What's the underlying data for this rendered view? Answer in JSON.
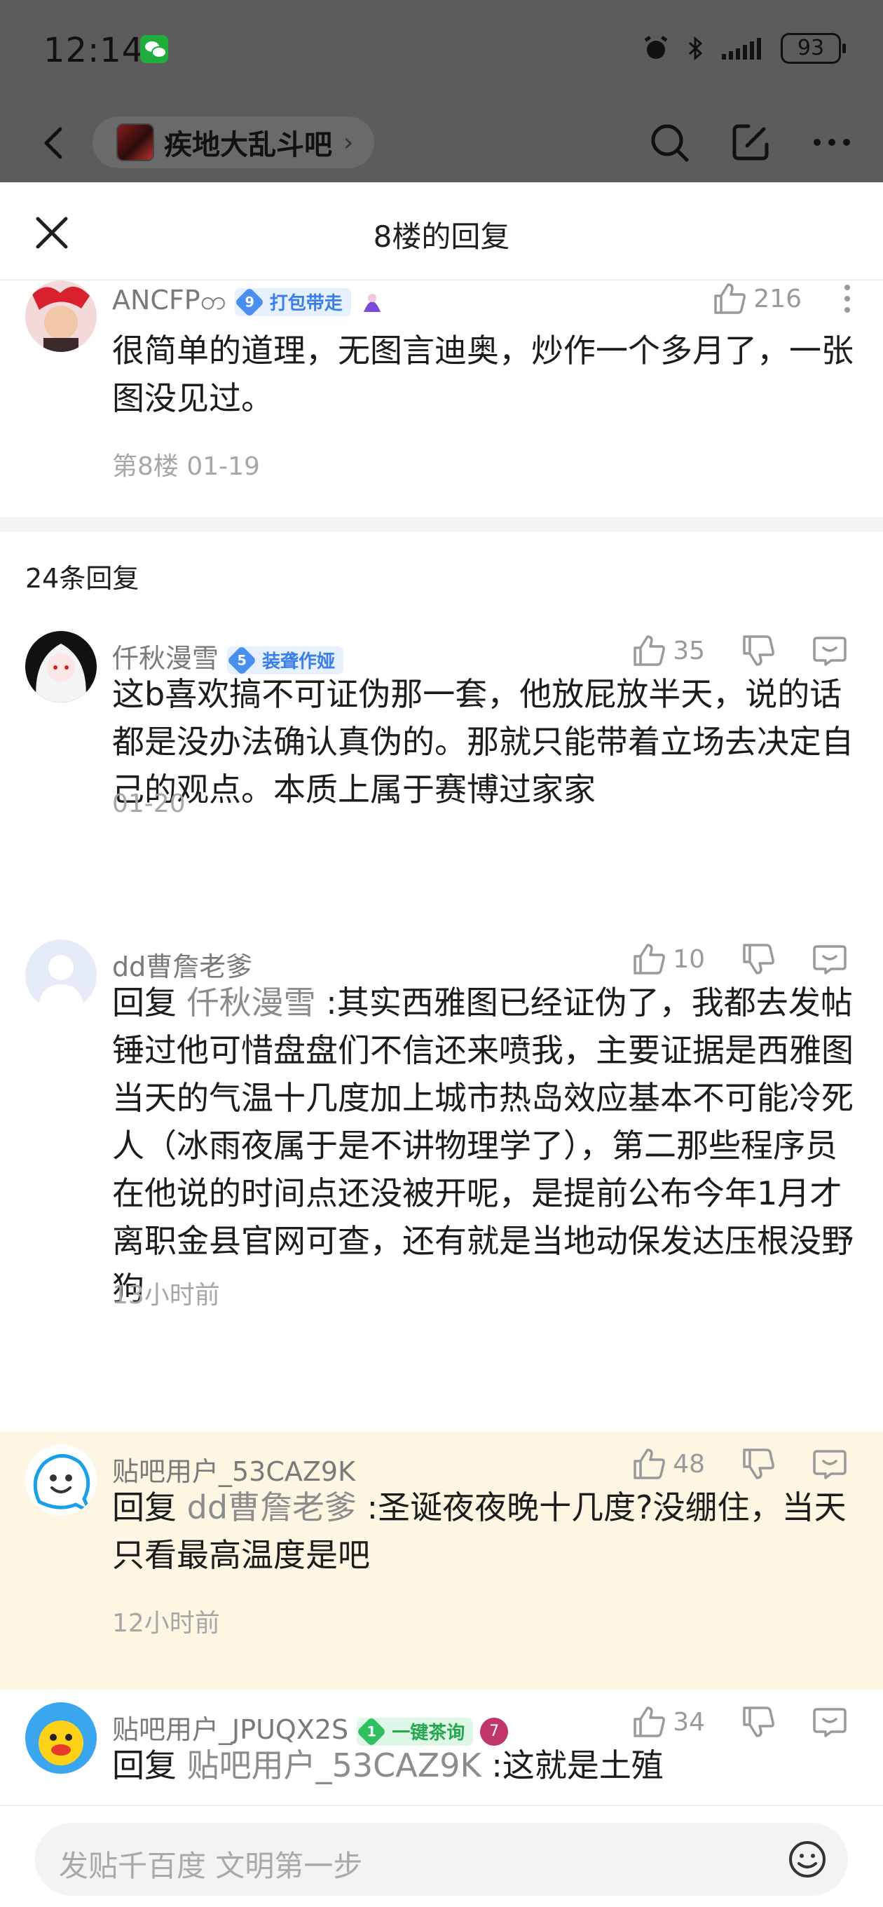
{
  "status_bar": {
    "time": "12:14",
    "battery": "93",
    "icons": [
      "wechat-icon",
      "alarm-icon",
      "bluetooth-icon",
      "signal-icon",
      "battery-icon"
    ]
  },
  "nav": {
    "forum_name": "疾地大乱斗吧",
    "chevron": "›",
    "icons": [
      "back-arrow-icon",
      "search-icon",
      "edit-icon",
      "more-icon"
    ]
  },
  "sheet": {
    "title": "8楼的回复"
  },
  "floor_post": {
    "username": "ANCFPတ",
    "level": "9",
    "badge": "打包带走",
    "likes": "216",
    "text": "很简单的道理，无图言迪奥，炒作一个多月了，一张图没见过。",
    "meta": "第8楼 01-19"
  },
  "reply_count": "24条回复",
  "replies": [
    {
      "username": "仟秋漫雪",
      "level": "5",
      "badge": "装聋作娅",
      "likes": "35",
      "text": "这b喜欢搞不可证伪那一套，他放屁放半天，说的话都是没办法确认真伪的。那就只能带着立场去决定自己的观点。本质上属于赛博过家家",
      "meta": "01-20"
    },
    {
      "username": "dd曹詹老爹",
      "likes": "10",
      "reply_prefix": "回复",
      "reply_target": "仟秋漫雪",
      "text": ":其实西雅图已经证伪了，我都去发帖锤过他可惜盘盘们不信还来喷我，主要证据是西雅图当天的气温十几度加上城市热岛效应基本不可能冷死人（冰雨夜属于是不讲物理学了），第二那些程序员在他说的时间点还没被开呢，是提前公布今年1月才离职金县官网可查，还有就是当地动保发达压根没野狗",
      "meta": "13小时前"
    },
    {
      "username": "贴吧用户_53CAZ9K",
      "likes": "48",
      "reply_prefix": "回复",
      "reply_target": "dd曹詹老爹",
      "text": ":圣诞夜夜晚十几度?没绷住，当天只看最高温度是吧",
      "meta": "12小时前"
    },
    {
      "username": "贴吧用户_JPUQX2S",
      "level": "1",
      "badge": "一键茶询",
      "medal": "7",
      "likes": "34",
      "reply_prefix": "回复",
      "reply_target": "贴吧用户_53CAZ9K",
      "text": ":这就是土殖"
    }
  ],
  "composer": {
    "placeholder": "发贴千百度 文明第一步"
  },
  "colors": {
    "like_gray": "#9a9a9a",
    "highlight_bg": "#fcf6e3",
    "badge_blue": "#3b7dea",
    "badge_green": "#25a84e"
  }
}
